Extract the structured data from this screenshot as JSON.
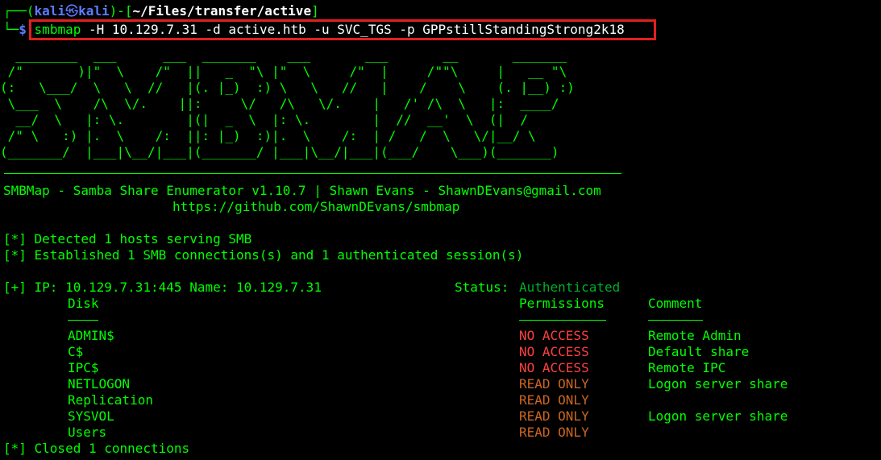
{
  "prompt": {
    "corner_top": "┌──(",
    "user": "kali",
    "at": "㉿",
    "host": "kali",
    "mid": ")-[",
    "path": "~/Files/transfer/active",
    "close": "]",
    "corner_bottom": "└─",
    "dollar": "$"
  },
  "command": {
    "program": "smbmap",
    "arg1_flag": "-H",
    "arg1_val": "10.129.7.31",
    "arg2_flag": "-d",
    "arg2_val": "active.htb",
    "arg3_flag": "-u",
    "arg3_val": "SVC_TGS",
    "arg4_flag": "-p",
    "arg4_val": "GPPstillStandingStrong2k18"
  },
  "banner_art": "  ________  ___      ___  _______    ___       ___       __       _______\n /\"       )|\"  \\    /\"  ||   _  \"\\ |\"  \\     /\"  |     /\"\"\\     |   __ \"\\\n(:   \\___/  \\   \\  //   |(. |_)  :) \\   \\   //   |    /    \\    (. |__) :)\n \\___  \\    /\\  \\/.    ||:     \\/   /\\   \\/.    |   /' /\\  \\   |:  ____/\n  __/  \\   |: \\.        |(|  _  \\  |: \\.        |  //  __'  \\  (|  /\n /\" \\   :) |.  \\    /:  ||: |_)  :)|.  \\    /:  | /   /  \\   \\/|__/ \\\n(_______/  |___|\\__/|___|(_______/ |___|\\__/|___|(___/    \\___)(_______)",
  "header": {
    "title": "SMBMap - Samba Share Enumerator v1.10.7 | Shawn Evans - ShawnDEvans@gmail.com",
    "url": "https://github.com/ShawnDEvans/smbmap"
  },
  "messages": {
    "detected": "[*] Detected 1 hosts serving SMB",
    "established": "[*] Established 1 SMB connections(s) and 1 authenticated session(s)"
  },
  "host": {
    "ip_line": "[+] IP: 10.129.7.31:445 Name: 10.129.7.31",
    "status_label": "Status:",
    "status_value": "Authenticated"
  },
  "table": {
    "headers": {
      "disk": "Disk",
      "permissions": "Permissions",
      "comment": "Comment"
    },
    "underlines": {
      "disk": "----",
      "permissions": "-----------",
      "comment": "-------"
    },
    "rows": [
      {
        "disk": "ADMIN$",
        "permissions": "NO ACCESS",
        "comment": "Remote Admin"
      },
      {
        "disk": "C$",
        "permissions": "NO ACCESS",
        "comment": "Default share"
      },
      {
        "disk": "IPC$",
        "permissions": "NO ACCESS",
        "comment": "Remote IPC"
      },
      {
        "disk": "NETLOGON",
        "permissions": "READ ONLY",
        "comment": "Logon server share"
      },
      {
        "disk": "Replication",
        "permissions": "READ ONLY",
        "comment": ""
      },
      {
        "disk": "SYSVOL",
        "permissions": "READ ONLY",
        "comment": "Logon server share"
      },
      {
        "disk": "Users",
        "permissions": "READ ONLY",
        "comment": ""
      }
    ]
  },
  "footer": {
    "closed": "[*] Closed 1 connections"
  },
  "colors": {
    "background": "#000000",
    "text_green": "#00ff00",
    "prompt_blue": "#5b7cff",
    "no_access_red": "#ff4040",
    "read_only_orange": "#cc6622",
    "highlight_red": "#e02020"
  }
}
